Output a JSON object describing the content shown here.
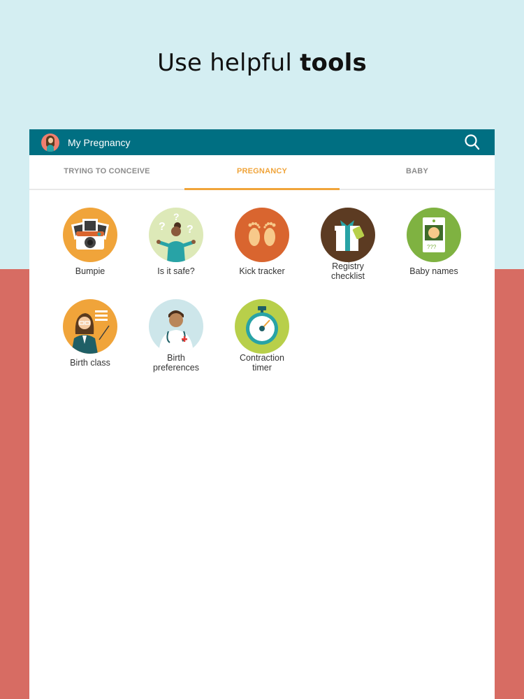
{
  "headline": {
    "normal": "Use helpful ",
    "bold": "tools"
  },
  "appbar": {
    "title": "My Pregnancy",
    "avatar_icon": "pregnant-woman-avatar",
    "search_icon": "search-icon"
  },
  "tabs": [
    {
      "label": "TRYING TO CONCEIVE",
      "active": false
    },
    {
      "label": "PREGNANCY",
      "active": true
    },
    {
      "label": "BABY",
      "active": false
    }
  ],
  "tools": [
    {
      "label": "Bumpie",
      "icon": "camera-photos-icon",
      "color": "#f0a43a"
    },
    {
      "label": "Is it safe?",
      "icon": "questioning-woman-icon",
      "color": "#dde9b8"
    },
    {
      "label": "Kick tracker",
      "icon": "footprints-icon",
      "color": "#d9652f"
    },
    {
      "label": "Registry checklist",
      "icon": "gift-box-icon",
      "color": "#5c3b22"
    },
    {
      "label": "Baby names",
      "icon": "baby-name-tag-icon",
      "color": "#7fb241"
    },
    {
      "label": "Birth class",
      "icon": "teacher-icon",
      "color": "#f0a43a"
    },
    {
      "label": "Birth preferences",
      "icon": "doctor-icon",
      "color": "#cde6ea"
    },
    {
      "label": "Contraction timer",
      "icon": "stopwatch-icon",
      "color": "#b8cf4a"
    }
  ],
  "colors": {
    "appbar": "#006f82",
    "accent": "#f0a43a",
    "top_bg": "#d4eef2",
    "bottom_bg": "#d76c63"
  }
}
